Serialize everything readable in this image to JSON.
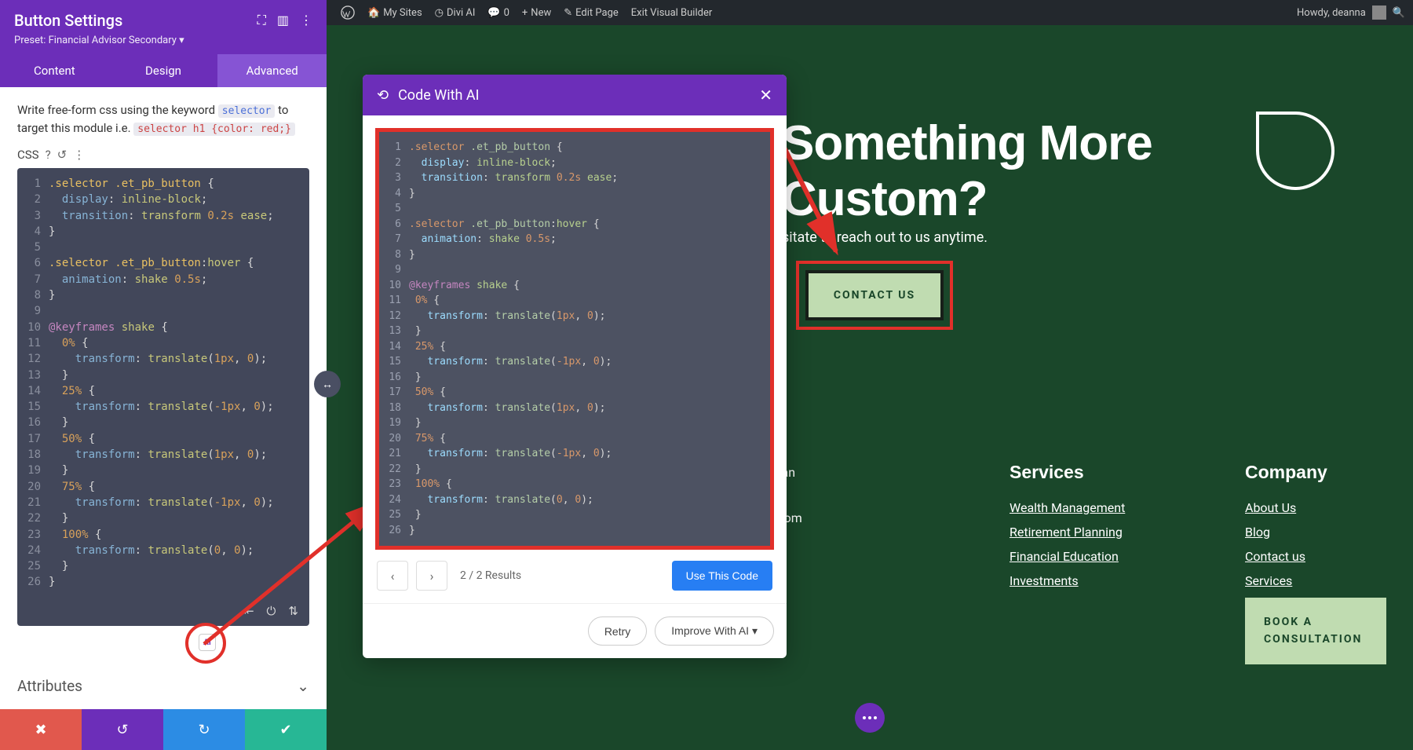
{
  "wpBar": {
    "mySites": "My Sites",
    "diviAI": "Divi AI",
    "comments": "0",
    "new": "New",
    "editPage": "Edit Page",
    "exitVB": "Exit Visual Builder",
    "howdy": "Howdy, deanna"
  },
  "sidebar": {
    "title": "Button Settings",
    "preset": "Preset: Financial Advisor Secondary ▾",
    "tabs": {
      "content": "Content",
      "design": "Design",
      "advanced": "Advanced"
    },
    "help1": "Write free-form css using the keyword ",
    "help_kw1": "selector",
    "help2": " to target this module i.e. ",
    "help_kw2": "selector h1 {color: red;}",
    "cssLabel": "CSS",
    "attributes": "Attributes",
    "aiBadge": "AI"
  },
  "cssLines": [
    {
      "n": 1,
      "html": "<span class='t-sel'>.selector .et_pb_button</span> <span class='t-punc'>{</span>"
    },
    {
      "n": 2,
      "html": "  <span class='t-prop'>display</span><span class='t-punc'>:</span> <span class='t-val'>inline-block</span><span class='t-punc'>;</span>"
    },
    {
      "n": 3,
      "html": "  <span class='t-prop'>transition</span><span class='t-punc'>:</span> <span class='t-val'>transform</span> <span class='t-num'>0.2s</span> <span class='t-val'>ease</span><span class='t-punc'>;</span>"
    },
    {
      "n": 4,
      "html": "<span class='t-punc'>}</span>"
    },
    {
      "n": 5,
      "html": ""
    },
    {
      "n": 6,
      "html": "<span class='t-sel'>.selector .et_pb_button</span><span class='t-punc'>:</span><span class='t-val'>hover</span> <span class='t-punc'>{</span>"
    },
    {
      "n": 7,
      "html": "  <span class='t-prop'>animation</span><span class='t-punc'>:</span> <span class='t-val'>shake</span> <span class='t-num'>0.5s</span><span class='t-punc'>;</span>"
    },
    {
      "n": 8,
      "html": "<span class='t-punc'>}</span>"
    },
    {
      "n": 9,
      "html": ""
    },
    {
      "n": 10,
      "html": "<span class='t-kw'>@keyframes</span> <span class='t-val'>shake</span> <span class='t-punc'>{</span>"
    },
    {
      "n": 11,
      "html": "  <span class='t-num'>0%</span> <span class='t-punc'>{</span>"
    },
    {
      "n": 12,
      "html": "    <span class='t-prop'>transform</span><span class='t-punc'>:</span> <span class='t-val'>translate</span><span class='t-punc'>(</span><span class='t-num'>1px</span><span class='t-punc'>,</span> <span class='t-num'>0</span><span class='t-punc'>);</span>"
    },
    {
      "n": 13,
      "html": "  <span class='t-punc'>}</span>"
    },
    {
      "n": 14,
      "html": "  <span class='t-num'>25%</span> <span class='t-punc'>{</span>"
    },
    {
      "n": 15,
      "html": "    <span class='t-prop'>transform</span><span class='t-punc'>:</span> <span class='t-val'>translate</span><span class='t-punc'>(</span><span class='t-num'>-1px</span><span class='t-punc'>,</span> <span class='t-num'>0</span><span class='t-punc'>);</span>"
    },
    {
      "n": 16,
      "html": "  <span class='t-punc'>}</span>"
    },
    {
      "n": 17,
      "html": "  <span class='t-num'>50%</span> <span class='t-punc'>{</span>"
    },
    {
      "n": 18,
      "html": "    <span class='t-prop'>transform</span><span class='t-punc'>:</span> <span class='t-val'>translate</span><span class='t-punc'>(</span><span class='t-num'>1px</span><span class='t-punc'>,</span> <span class='t-num'>0</span><span class='t-punc'>);</span>"
    },
    {
      "n": 19,
      "html": "  <span class='t-punc'>}</span>"
    },
    {
      "n": 20,
      "html": "  <span class='t-num'>75%</span> <span class='t-punc'>{</span>"
    },
    {
      "n": 21,
      "html": "    <span class='t-prop'>transform</span><span class='t-punc'>:</span> <span class='t-val'>translate</span><span class='t-punc'>(</span><span class='t-num'>-1px</span><span class='t-punc'>,</span> <span class='t-num'>0</span><span class='t-punc'>);</span>"
    },
    {
      "n": 22,
      "html": "  <span class='t-punc'>}</span>"
    },
    {
      "n": 23,
      "html": "  <span class='t-num'>100%</span> <span class='t-punc'>{</span>"
    },
    {
      "n": 24,
      "html": "    <span class='t-prop'>transform</span><span class='t-punc'>:</span> <span class='t-val'>translate</span><span class='t-punc'>(</span><span class='t-num'>0</span><span class='t-punc'>,</span> <span class='t-num'>0</span><span class='t-punc'>);</span>"
    },
    {
      "n": 25,
      "html": "  <span class='t-punc'>}</span>"
    },
    {
      "n": 26,
      "html": "<span class='t-punc'>}</span>"
    }
  ],
  "aiModal": {
    "title": "Code With AI",
    "results": "2 / 2 Results",
    "useBtn": "Use This Code",
    "retry": "Retry",
    "improve": "Improve With AI  ▾"
  },
  "aiLines": [
    {
      "n": 1,
      "html": "<span class='a-sel'>.selector</span> <span class='a-cls'>.et_pb_button</span> {"
    },
    {
      "n": 2,
      "html": "  <span class='a-prop'>display</span>: <span class='a-val'>inline-block</span>;"
    },
    {
      "n": 3,
      "html": "  <span class='a-prop'>transition</span>: <span class='a-val'>transform</span> <span class='a-num'>0.2s</span> <span class='a-val'>ease</span>;"
    },
    {
      "n": 4,
      "html": "}"
    },
    {
      "n": 5,
      "html": ""
    },
    {
      "n": 6,
      "html": "<span class='a-sel'>.selector</span> <span class='a-cls'>.et_pb_button</span>:<span class='a-val'>hover</span> {"
    },
    {
      "n": 7,
      "html": "  <span class='a-prop'>animation</span>: <span class='a-val'>shake</span> <span class='a-num'>0.5s</span>;"
    },
    {
      "n": 8,
      "html": "}"
    },
    {
      "n": 9,
      "html": ""
    },
    {
      "n": 10,
      "html": "<span class='a-kw'>@keyframes</span> <span class='a-val'>shake</span> {"
    },
    {
      "n": 11,
      "html": " <span class='a-num'>0%</span> {"
    },
    {
      "n": 12,
      "html": "   <span class='a-prop'>transform</span>: <span class='a-fn'>translate</span>(<span class='a-num'>1px</span>, <span class='a-num'>0</span>);"
    },
    {
      "n": 13,
      "html": " }"
    },
    {
      "n": 14,
      "html": " <span class='a-num'>25%</span> {"
    },
    {
      "n": 15,
      "html": "   <span class='a-prop'>transform</span>: <span class='a-fn'>translate</span>(<span class='a-num'>-1px</span>, <span class='a-num'>0</span>);"
    },
    {
      "n": 16,
      "html": " }"
    },
    {
      "n": 17,
      "html": " <span class='a-num'>50%</span> {"
    },
    {
      "n": 18,
      "html": "   <span class='a-prop'>transform</span>: <span class='a-fn'>translate</span>(<span class='a-num'>1px</span>, <span class='a-num'>0</span>);"
    },
    {
      "n": 19,
      "html": " }"
    },
    {
      "n": 20,
      "html": " <span class='a-num'>75%</span> {"
    },
    {
      "n": 21,
      "html": "   <span class='a-prop'>transform</span>: <span class='a-fn'>translate</span>(<span class='a-num'>-1px</span>, <span class='a-num'>0</span>);"
    },
    {
      "n": 22,
      "html": " }"
    },
    {
      "n": 23,
      "html": " <span class='a-num'>100%</span> {"
    },
    {
      "n": 24,
      "html": "   <span class='a-prop'>transform</span>: <span class='a-fn'>translate</span>(<span class='a-num'>0</span>, <span class='a-num'>0</span>);"
    },
    {
      "n": 25,
      "html": " }"
    },
    {
      "n": 26,
      "html": "}"
    }
  ],
  "page": {
    "heroTitle": "Something More\nCustom?",
    "heroSub": "sitate to reach out to us anytime.",
    "contactBtn": "CONTACT US",
    "addr": "San\n\n.com",
    "services": {
      "h": "Services",
      "links": [
        "Wealth Management",
        "Retirement Planning",
        "Financial Education",
        "Investments"
      ]
    },
    "company": {
      "h": "Company",
      "links": [
        "About Us",
        "Blog",
        "Contact us",
        "Services"
      ],
      "book": "BOOK A\nCONSULTATION"
    }
  }
}
